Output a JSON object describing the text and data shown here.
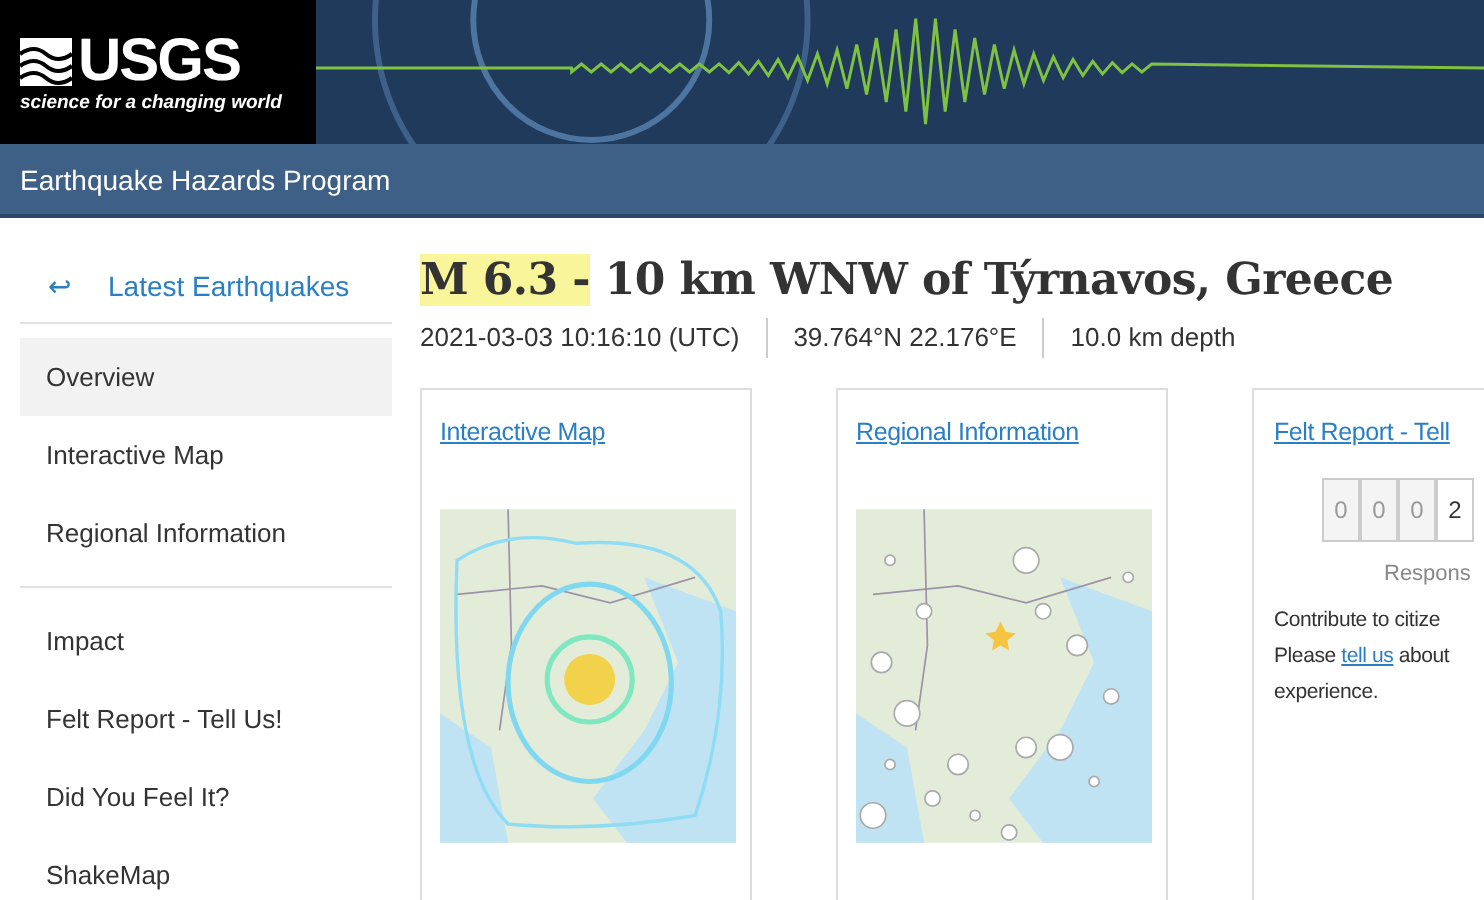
{
  "header": {
    "logo": "USGS",
    "tagline": "science for a changing world"
  },
  "nav_bar": {
    "title": "Earthquake Hazards Program"
  },
  "sidebar": {
    "back_link": {
      "icon": "↩",
      "label": "Latest Earthquakes"
    },
    "groups": [
      [
        {
          "label": "Overview",
          "selected": true
        },
        {
          "label": "Interactive Map",
          "selected": false
        },
        {
          "label": "Regional Information",
          "selected": false
        }
      ],
      [
        {
          "label": "Impact",
          "selected": false
        },
        {
          "label": "Felt Report - Tell Us!",
          "selected": false
        },
        {
          "label": "Did You Feel It?",
          "selected": false
        },
        {
          "label": "ShakeMap",
          "selected": false
        }
      ]
    ]
  },
  "event": {
    "title_highlighted": "M 6.3 -",
    "title": "10 km WNW of Týrnavos, Greece",
    "details": [
      "2021-03-03 10:16:10 (UTC)",
      "39.764°N 22.176°E",
      "10.0 km depth"
    ]
  },
  "cards": [
    {
      "kind": "map",
      "title": "Interactive Map"
    },
    {
      "kind": "map",
      "title": "Regional Information"
    },
    {
      "kind": "felt",
      "title": "Felt Report - Tell",
      "counter": [
        "0",
        "0",
        "0",
        "2"
      ],
      "counter_label": "Respons",
      "lines": [
        {
          "text": "Contribute to citize"
        },
        {
          "before": "Please",
          "link": "tell us",
          "after": "about"
        },
        {
          "text": "experience."
        }
      ]
    }
  ]
}
